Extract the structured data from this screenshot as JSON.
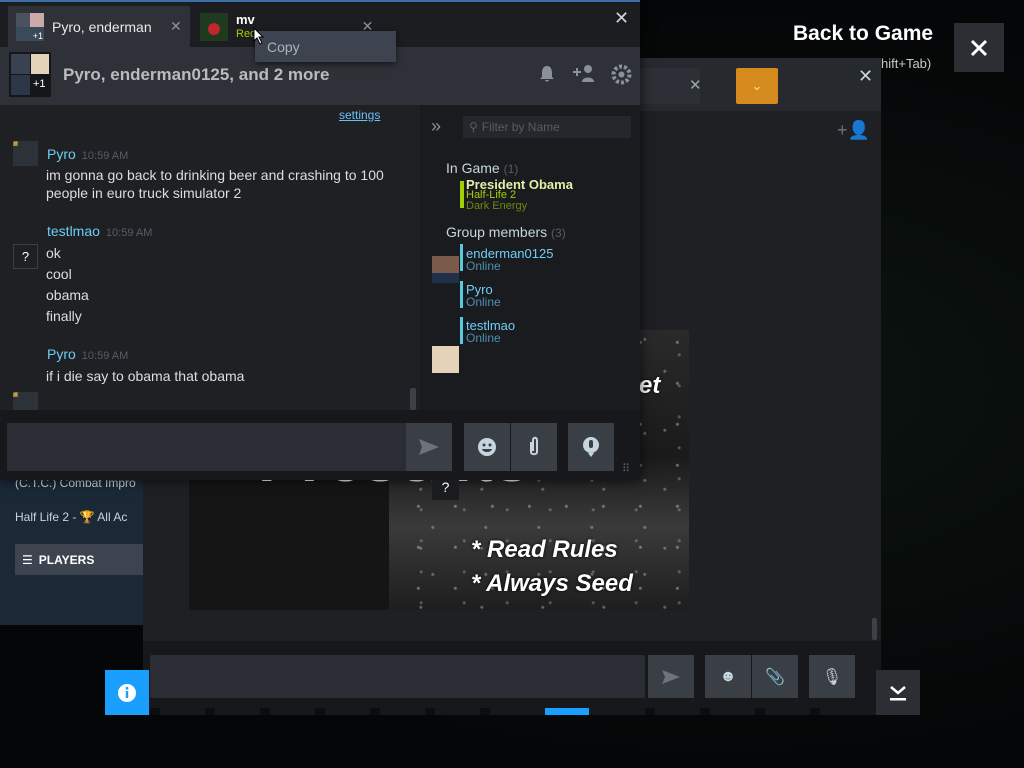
{
  "overlay": {
    "back_to_game": "Back to Game",
    "back_hint": "Shift+Tab",
    "close_icon": "close-icon"
  },
  "left_panel": {
    "rows": [
      "(C.T.C.) Combat Impro",
      "Half Life 2 - 🏆 All Ac"
    ],
    "players_label": "PLAYERS"
  },
  "back_window": {
    "banner_lines": [
      "et",
      "Presents",
      "* Read Rules",
      "* Always Seed"
    ]
  },
  "chat": {
    "tabs": [
      {
        "label": "Pyro, enderman",
        "badge": "+1"
      },
      {
        "label": "mv",
        "status": "Rec"
      }
    ],
    "context_menu": {
      "items": [
        "Copy"
      ]
    },
    "header": {
      "title": "Pyro, enderman0125, and 2 more",
      "avatar_badge": "+1"
    },
    "settings_link": "settings",
    "messages": [
      {
        "author": "Pyro",
        "time": "10:59 AM",
        "lines": [
          "im gonna go back to drinking beer and crashing to 100 people in euro truck simulator 2"
        ]
      },
      {
        "author": "testlmao",
        "time": "10:59 AM",
        "lines": [
          "ok",
          "cool",
          "obama",
          "finally"
        ]
      },
      {
        "author": "Pyro",
        "time": "10:59 AM",
        "lines": [
          "if i die say to obama that obama"
        ]
      }
    ],
    "members": {
      "filter_placeholder": "Filter by Name",
      "in_game": {
        "label": "In Game",
        "count": "(1)",
        "members": [
          {
            "name": "President Obama",
            "game": "Half-Life 2",
            "detail": "Dark Energy"
          }
        ]
      },
      "group": {
        "label": "Group members",
        "count": "(3)",
        "members": [
          {
            "name": "enderman0125",
            "status": "Online"
          },
          {
            "name": "Pyro",
            "status": "Online"
          },
          {
            "name": "testlmao",
            "status": "Online"
          }
        ]
      }
    }
  },
  "colors": {
    "accent": "#1a9fff",
    "online": "#6dcff6",
    "in_game": "#a3cf06",
    "chat_bg": "#1e2024"
  }
}
